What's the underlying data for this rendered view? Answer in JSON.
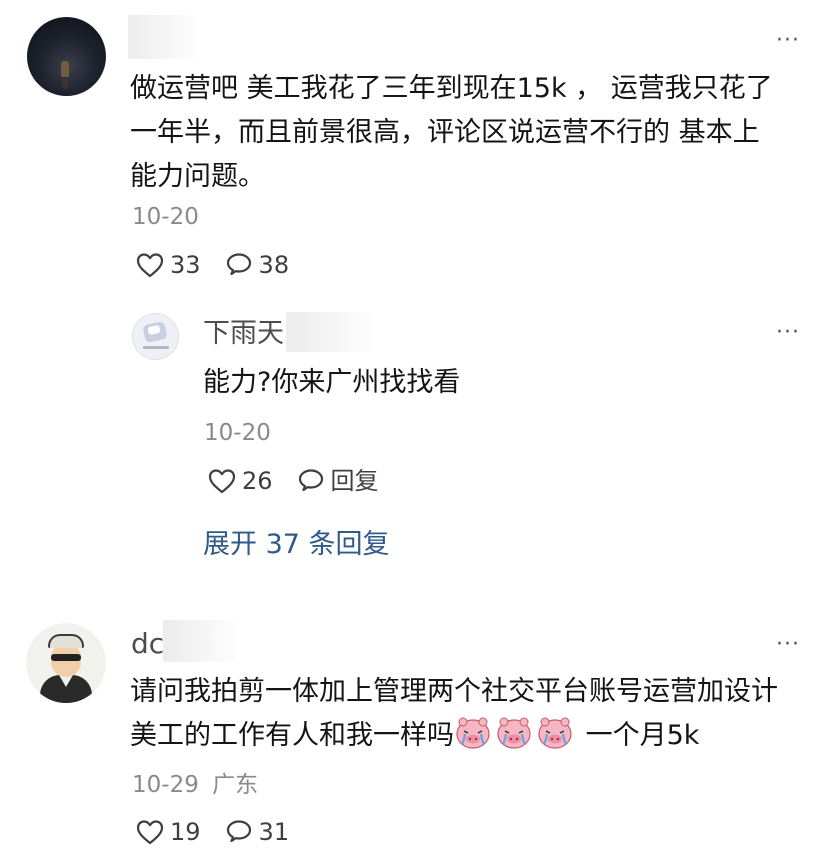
{
  "comments": [
    {
      "name_visible": "",
      "text_lines": [
        "做运营吧 美工我花了三年到现在15k ， 运营我只花了",
        "一年半，而且前景很高，评论区说运营不行的 基本上",
        "能力问题。"
      ],
      "date": "10-20",
      "likes": "33",
      "replies": "38",
      "more": "···",
      "reply": {
        "name_visible": "下雨天",
        "text": "能力?你来广州找找看",
        "date": "10-20",
        "likes": "26",
        "reply_label": "回复",
        "more": "···"
      },
      "expand_label": "展开 37 条回复"
    },
    {
      "name_visible": "dc",
      "text_line_1": "请问我拍剪一体加上管理两个社交平台账号运营加设计",
      "text_line_2_start": "美工的工作有人和我一样吗",
      "text_line_2_end": " 一个月5k",
      "date": "10-29",
      "location": "广东",
      "likes": "19",
      "replies": "31",
      "more": "···",
      "emoji_count": 3
    }
  ],
  "icons": {
    "like": "heart-outline-icon",
    "comment": "speech-bubble-icon",
    "more": "more-dots-icon",
    "emoji": "crying-pig-emoji-icon"
  },
  "colors": {
    "link": "#2f5a8a",
    "meta": "#8a8a8a"
  }
}
